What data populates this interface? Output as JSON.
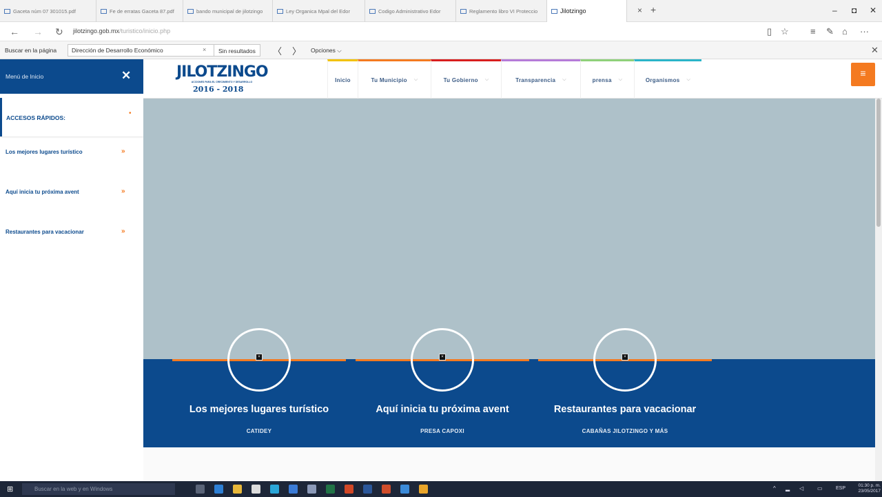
{
  "browser": {
    "tabs": [
      {
        "label": "Gaceta núm 07 301015.pdf",
        "active": false
      },
      {
        "label": "Fe de erratas Gaceta 87.pdf",
        "active": false
      },
      {
        "label": "bando municipal de jilotzingo",
        "active": false
      },
      {
        "label": "Ley Organica Mpal del Edor",
        "active": false
      },
      {
        "label": "Codigo Administrativo Edor",
        "active": false
      },
      {
        "label": "Reglamento libro VI Proteccio",
        "active": false
      },
      {
        "label": "Jilotzingo",
        "active": true
      }
    ],
    "tab_close": "×",
    "new_tab": "+",
    "window": {
      "minimize": "–",
      "maximize": "◘",
      "close": "✕"
    },
    "nav": {
      "back": "←",
      "forward": "→",
      "refresh": "↻"
    },
    "url_domain": "jilotzingo.gob.mx",
    "url_path": "/turistico/inicio.php",
    "toolbar_icons": {
      "reading_view": "▯",
      "favorite": "☆",
      "hub": "≡",
      "notes": "✎",
      "share": "⌂",
      "more": "···"
    }
  },
  "findbar": {
    "label": "Buscar en la página",
    "query": "Dirección de Desarrollo Económico",
    "clear": "×",
    "results": "Sin resultados",
    "prev": "〈",
    "next": "〉",
    "options": "Opciones ⌵",
    "close": "✕"
  },
  "sidebar": {
    "title": "Menú de Inicio",
    "close": "✕",
    "quick_label": "ACCESOS RÁPIDOS:",
    "quick_dot": "•",
    "items": [
      {
        "label": "Los mejores lugares turístico",
        "arrow": "»"
      },
      {
        "label": "Aquí inicia tu próxima avent",
        "arrow": "»"
      },
      {
        "label": "Restaurantes para vacacionar",
        "arrow": "»"
      }
    ]
  },
  "header": {
    "logo_title": "JILOTZINGO",
    "logo_tagline": "ACCIONES PARA EL CRECIMIENTO Y DESARROLLO",
    "logo_years": "2016 - 2018",
    "menu_icon": "≡",
    "nav": [
      {
        "label": "Inicio",
        "color": "#f2c200",
        "caret": false
      },
      {
        "label": "Tu Municipio",
        "color": "#f47a20",
        "caret": true
      },
      {
        "label": "Tu Gobierno",
        "color": "#d81e1e",
        "caret": true
      },
      {
        "label": "Transparencia",
        "color": "#b57bd8",
        "caret": true
      },
      {
        "label": "prensa",
        "color": "#8fd17a",
        "caret": true
      },
      {
        "label": "Organismos",
        "color": "#2ab4c8",
        "caret": true
      }
    ]
  },
  "cards": [
    {
      "title": "Los mejores lugares turístico",
      "subtitle": "CATIDEY",
      "icon": "broken-image-icon"
    },
    {
      "title": "Aquí inicia tu próxima avent",
      "subtitle": "PRESA CAPOXI",
      "icon": "broken-image-icon"
    },
    {
      "title": "Restaurantes para vacacionar",
      "subtitle": "CABAÑAS JILOTZINGO Y MÁS",
      "icon": "broken-image-icon"
    }
  ],
  "colors": {
    "brand_blue": "#0c4a8d",
    "accent_orange": "#f47a20",
    "hero_gray": "#aec1c9"
  },
  "taskbar": {
    "search_placeholder": "Buscar en la web y en Windows",
    "language": "ESP",
    "time": "01:30 p. m.",
    "date": "23/05/2017"
  }
}
